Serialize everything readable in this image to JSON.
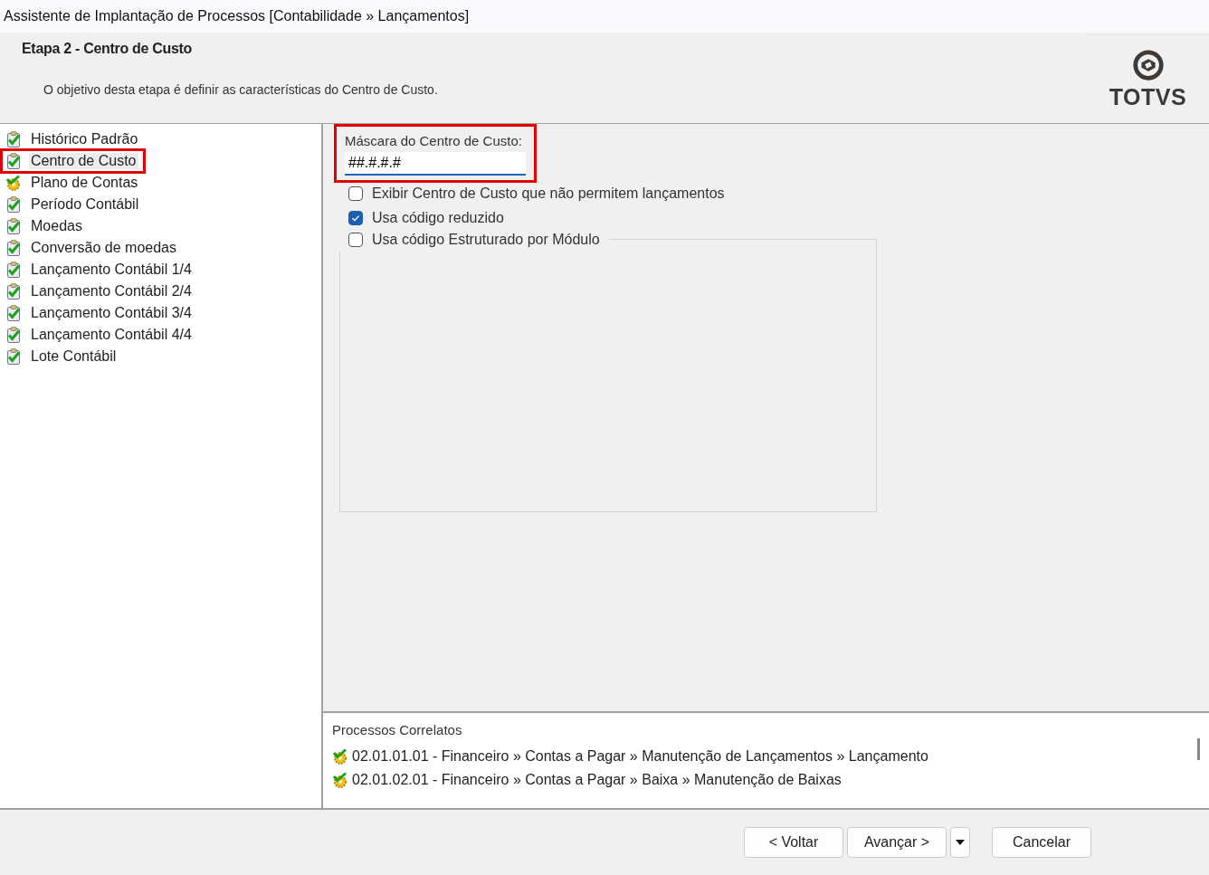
{
  "window": {
    "title": "Assistente de Implantação de Processos [Contabilidade » Lançamentos]"
  },
  "header": {
    "title": "Etapa 2 - Centro de Custo",
    "description": "O objetivo desta etapa é definir as características do Centro de Custo.",
    "logo": "TOTVS"
  },
  "steps": [
    {
      "label": "Histórico Padrão",
      "kind": "done",
      "selected": false,
      "highlighted": false
    },
    {
      "label": "Centro de Custo",
      "kind": "done",
      "selected": true,
      "highlighted": true
    },
    {
      "label": "Plano de Contas",
      "kind": "pending",
      "selected": false,
      "highlighted": false
    },
    {
      "label": "Período Contábil",
      "kind": "done",
      "selected": false,
      "highlighted": false
    },
    {
      "label": "Moedas",
      "kind": "done",
      "selected": false,
      "highlighted": false
    },
    {
      "label": "Conversão de moedas",
      "kind": "done",
      "selected": false,
      "highlighted": false
    },
    {
      "label": "Lançamento Contábil 1/4",
      "kind": "done",
      "selected": false,
      "highlighted": false
    },
    {
      "label": "Lançamento Contábil 2/4",
      "kind": "done",
      "selected": false,
      "highlighted": false
    },
    {
      "label": "Lançamento Contábil 3/4",
      "kind": "done",
      "selected": false,
      "highlighted": false
    },
    {
      "label": "Lançamento Contábil 4/4",
      "kind": "done",
      "selected": false,
      "highlighted": false
    },
    {
      "label": "Lote Contábil",
      "kind": "done",
      "selected": false,
      "highlighted": false
    }
  ],
  "mask_field": {
    "label": "Máscara do Centro de Custo:",
    "value": "##.#.#.#",
    "highlighted": true
  },
  "options": [
    {
      "label": "Exibir Centro de Custo que não permitem lançamentos",
      "checked": false
    },
    {
      "label": "Usa código reduzido",
      "checked": true
    }
  ],
  "module_group": {
    "label": "Usa código Estruturado por Módulo",
    "checked": false
  },
  "related": {
    "title": "Processos Correlatos",
    "items": [
      "02.01.01.01 - Financeiro » Contas a Pagar » Manutenção de Lançamentos » Lançamento",
      "02.01.02.01 - Financeiro » Contas a Pagar » Baixa » Manutenção de Baixas"
    ]
  },
  "buttons": {
    "back": "< Voltar",
    "next": "Avançar >",
    "cancel": "Cancelar"
  }
}
